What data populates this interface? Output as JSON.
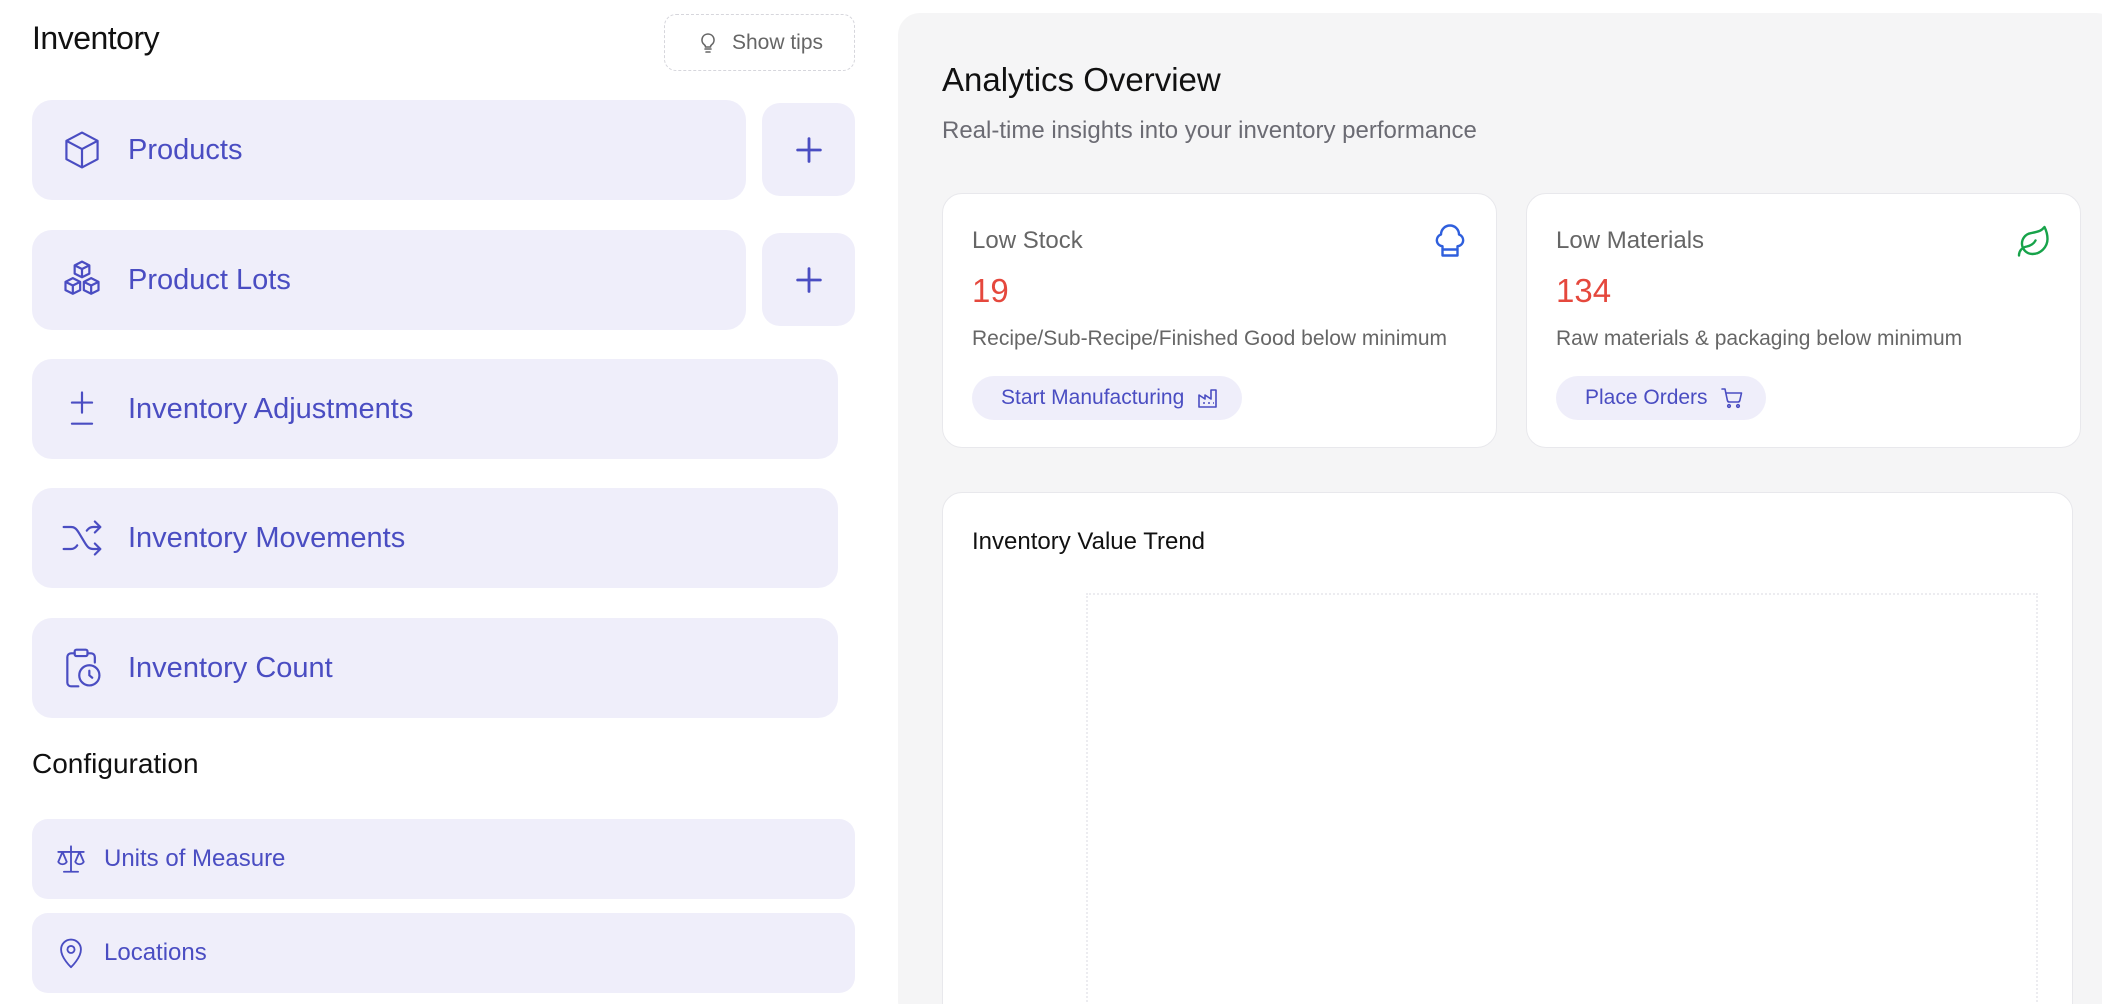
{
  "sidebar": {
    "title": "Inventory",
    "show_tips": "Show tips",
    "nav": [
      {
        "label": "Products",
        "icon": "box-icon",
        "has_add": true
      },
      {
        "label": "Product Lots",
        "icon": "boxes-icon",
        "has_add": true
      },
      {
        "label": "Inventory Adjustments",
        "icon": "plus-minus-icon",
        "has_add": false
      },
      {
        "label": "Inventory Movements",
        "icon": "shuffle-icon",
        "has_add": false
      },
      {
        "label": "Inventory Count",
        "icon": "clipboard-clock-icon",
        "has_add": false
      }
    ],
    "config_title": "Configuration",
    "config": [
      {
        "label": "Units of Measure",
        "icon": "scale-icon"
      },
      {
        "label": "Locations",
        "icon": "map-pin-icon"
      }
    ]
  },
  "analytics": {
    "title": "Analytics Overview",
    "subtitle": "Real-time insights into your inventory performance",
    "cards": [
      {
        "label": "Low Stock",
        "value": "19",
        "desc": "Recipe/Sub-Recipe/Finished Good below minimum",
        "button": "Start Manufacturing",
        "icon": "chef-hat-icon",
        "icon_color": "#2f5fdd",
        "button_icon": "factory-icon"
      },
      {
        "label": "Low Materials",
        "value": "134",
        "desc": "Raw materials & packaging below minimum",
        "button": "Place Orders",
        "icon": "leaf-icon",
        "icon_color": "#17a34a",
        "button_icon": "cart-icon"
      }
    ],
    "trend_title": "Inventory Value Trend"
  },
  "colors": {
    "accent": "#4a4dc2",
    "card_bg": "#efeefa",
    "alert": "#e5483d"
  }
}
